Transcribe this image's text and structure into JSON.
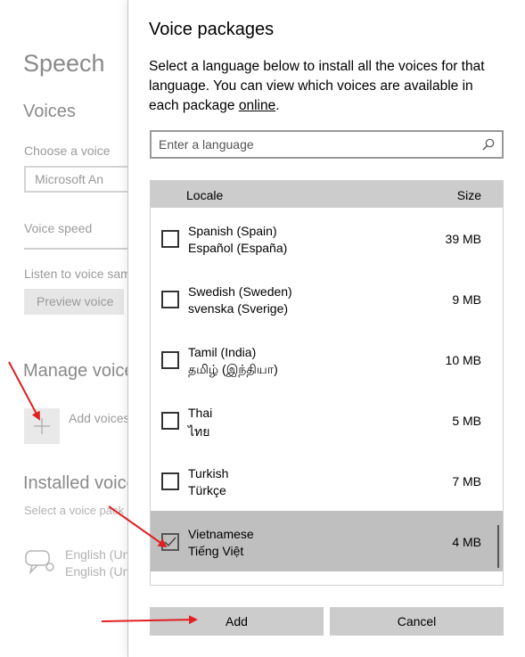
{
  "background": {
    "title": "Speech",
    "voices_heading": "Voices",
    "choose_voice_label": "Choose a voice",
    "voice_dropdown_value": "Microsoft An",
    "voice_speed_label": "Voice speed",
    "listen_label": "Listen to voice sam",
    "preview_button": "Preview voice",
    "manage_voices_heading": "Manage voice",
    "add_voices_label": "Add voices",
    "installed_voices_heading": "Installed voice",
    "select_voice_pack_label": "Select a voice pack",
    "installed_line1": "English (Un",
    "installed_line2": "English (Un"
  },
  "dialog": {
    "title": "Voice packages",
    "description_prefix": "Select a language below to install all the voices for that language. You can view which voices are available in each package ",
    "description_link": "online",
    "description_suffix": ".",
    "search": {
      "placeholder": "Enter a language",
      "value": ""
    },
    "table": {
      "header_locale": "Locale",
      "header_size": "Size",
      "rows": [
        {
          "name": "Spanish (Spain)",
          "native": "Español (España)",
          "size": "39 MB",
          "checked": false
        },
        {
          "name": "Swedish (Sweden)",
          "native": "svenska (Sverige)",
          "size": "9 MB",
          "checked": false
        },
        {
          "name": "Tamil (India)",
          "native": "தமிழ் (இந்தியா)",
          "size": "10 MB",
          "checked": false
        },
        {
          "name": "Thai",
          "native": "ไทย",
          "size": "5 MB",
          "checked": false
        },
        {
          "name": "Turkish",
          "native": "Türkçe",
          "size": "7 MB",
          "checked": false
        },
        {
          "name": "Vietnamese",
          "native": "Tiếng Việt",
          "size": "4 MB",
          "checked": true
        }
      ]
    },
    "buttons": {
      "add": "Add",
      "cancel": "Cancel"
    }
  },
  "colors": {
    "annotation_arrow": "#e02020",
    "selected_row": "#bfbfbf",
    "header_bg": "#cccccc"
  },
  "icons": {
    "search": "search-icon",
    "add": "plus-icon",
    "installed_voice": "speech-bubble-icon",
    "checkmark": "checkmark-icon"
  }
}
